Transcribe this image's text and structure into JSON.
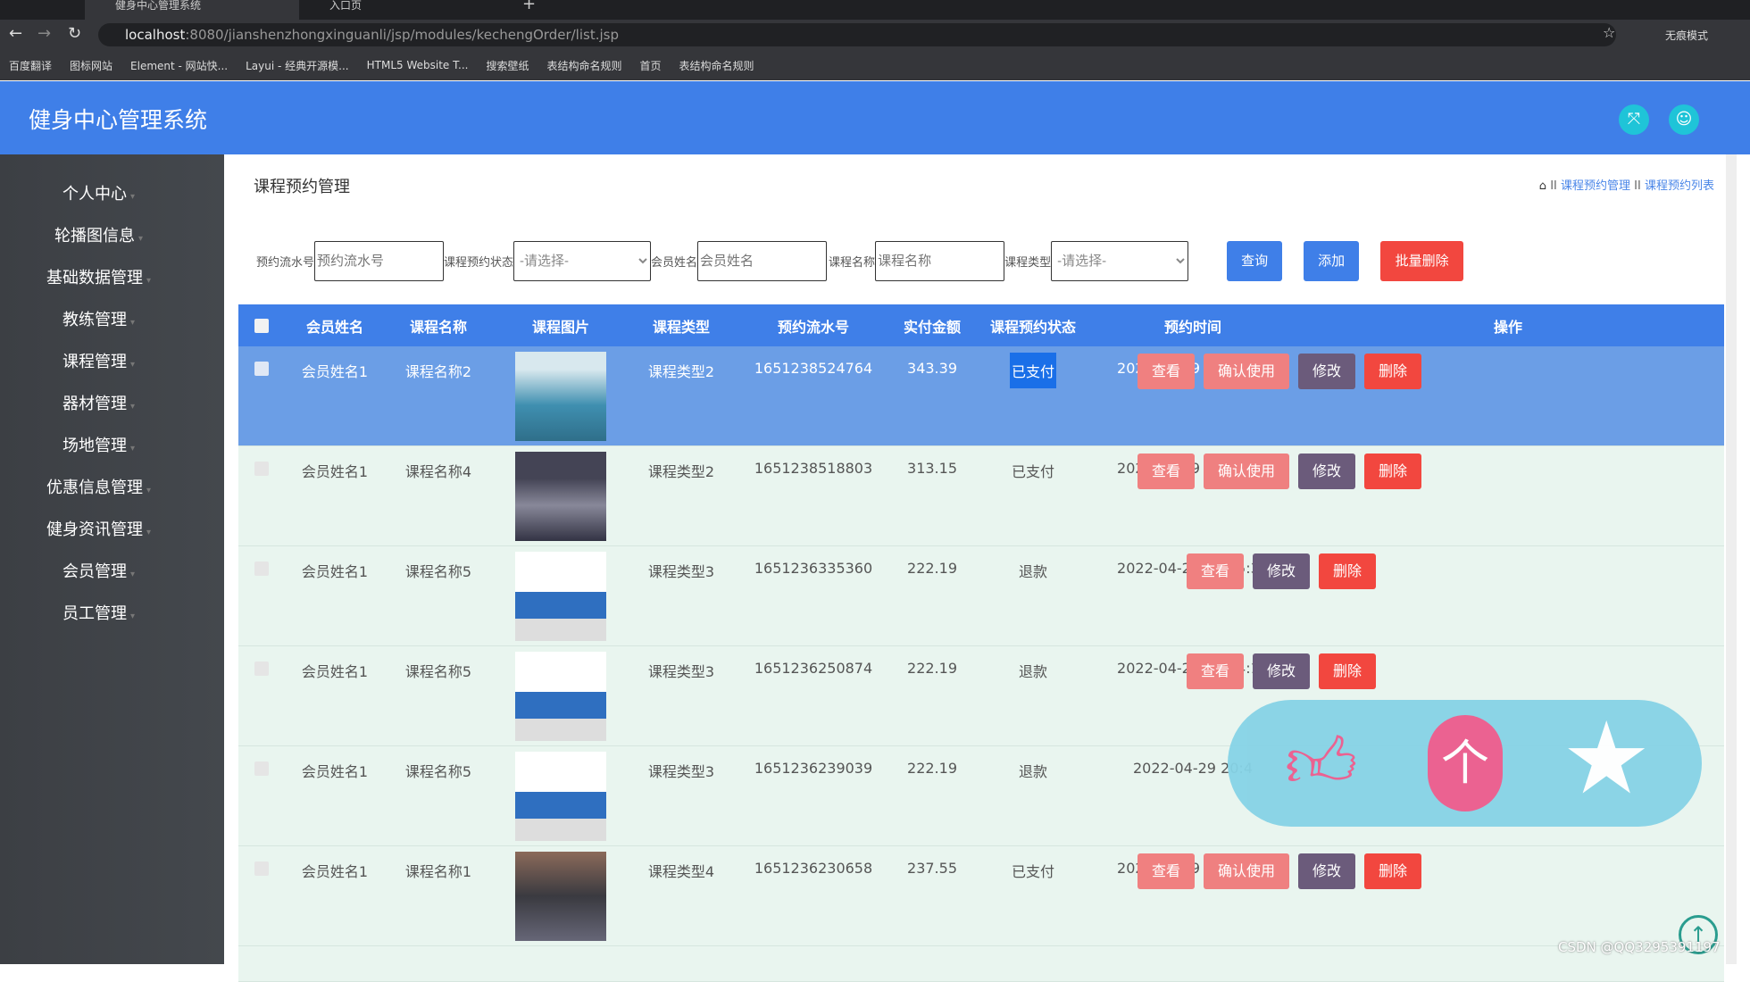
{
  "browser": {
    "tabs": [
      {
        "title": "健身中心管理系统"
      },
      {
        "title": "入口页"
      }
    ],
    "url_host": "localhost",
    "url_rest": ":8080/jianshenzhongxinguanli/jsp/modules/kechengOrder/list.jsp",
    "profile": "无痕模式",
    "bookmarks": [
      "百度翻译",
      "图标网站",
      "Element - 网站快...",
      "Layui - 经典开源模...",
      "HTML5 Website T...",
      "搜索壁纸",
      "表结构命名规则",
      "首页",
      "表结构命名规则"
    ]
  },
  "header": {
    "title": "健身中心管理系统"
  },
  "sidebar": {
    "items": [
      "个人中心",
      "轮播图信息",
      "基础数据管理",
      "教练管理",
      "课程管理",
      "器材管理",
      "场地管理",
      "优惠信息管理",
      "健身资讯管理",
      "会员管理",
      "员工管理"
    ]
  },
  "page": {
    "title": "课程预约管理",
    "breadcrumb": [
      "课程预约管理",
      "课程预约列表"
    ]
  },
  "filters": {
    "order_no_label": "预约流水号",
    "order_no_placeholder": "预约流水号",
    "status_label": "课程预约状态",
    "status_value": "-请选择-",
    "member_label": "会员姓名",
    "member_placeholder": "会员姓名",
    "course_label": "课程名称",
    "course_placeholder": "课程名称",
    "type_label": "课程类型",
    "type_value": "-请选择-",
    "query": "查询",
    "add": "添加",
    "batch_delete": "批量删除"
  },
  "table": {
    "columns": [
      "会员姓名",
      "课程名称",
      "课程图片",
      "课程类型",
      "预约流水号",
      "实付金额",
      "课程预约状态",
      "预约时间",
      "操作"
    ],
    "rows": [
      {
        "member": "会员姓名1",
        "course": "课程名称2",
        "type": "课程类型2",
        "no": "1651238524764",
        "amount": "343.39",
        "status": "已支付",
        "time": "2022-04-29 21:22:05",
        "ops": [
          "查看",
          "确认使用",
          "修改",
          "删除"
        ]
      },
      {
        "member": "会员姓名1",
        "course": "课程名称4",
        "type": "课程类型2",
        "no": "1651238518803",
        "amount": "313.15",
        "status": "已支付",
        "time": "2022-04-29 21:21:59",
        "ops": [
          "查看",
          "确认使用",
          "修改",
          "删除"
        ]
      },
      {
        "member": "会员姓名1",
        "course": "课程名称5",
        "type": "课程类型3",
        "no": "1651236335360",
        "amount": "222.19",
        "status": "退款",
        "time": "2022-04-29 20:45:35",
        "ops": [
          "查看",
          "修改",
          "删除"
        ]
      },
      {
        "member": "会员姓名1",
        "course": "课程名称5",
        "type": "课程类型3",
        "no": "1651236250874",
        "amount": "222.19",
        "status": "退款",
        "time": "2022-04-29 20:44:11",
        "ops": [
          "查看",
          "修改",
          "删除"
        ]
      },
      {
        "member": "会员姓名1",
        "course": "课程名称5",
        "type": "课程类型3",
        "no": "1651236239039",
        "amount": "222.19",
        "status": "退款",
        "time": "2022-04-29 20:4",
        "ops": []
      },
      {
        "member": "会员姓名1",
        "course": "课程名称1",
        "type": "课程类型4",
        "no": "1651236230658",
        "amount": "237.55",
        "status": "已支付",
        "time": "2022-04-29 20:43:51",
        "ops": [
          "查看",
          "确认使用",
          "修改",
          "删除"
        ]
      }
    ]
  },
  "watermark": "CSDN @QQ3295391197",
  "colors": {
    "primary": "#3f7fe8",
    "view": "#f08080",
    "confirm": "#ef8080",
    "edit": "#6b5b7b",
    "delete": "#f2473f"
  }
}
